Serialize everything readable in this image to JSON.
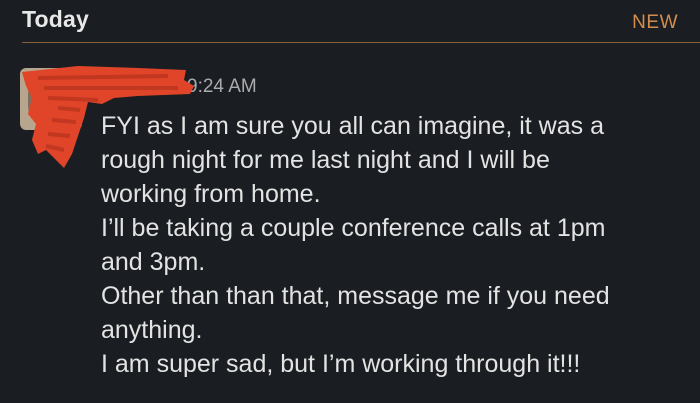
{
  "section": {
    "title": "Today",
    "badge": "NEW"
  },
  "colors": {
    "background": "#1a1d21",
    "accent": "#d38d4e",
    "redaction": "#e0452a",
    "text": "#e3e3e3",
    "muted": "#ababad"
  },
  "message": {
    "avatar_icon": "user-avatar-photo-redacted",
    "sender_redacted": true,
    "timestamp": "9:24 AM",
    "lines": [
      "FYI as I am sure you all can imagine, it was a",
      "rough night for me last night and I will be",
      "working from home.",
      "I’ll be taking a couple conference calls at 1pm",
      "and 3pm.",
      "Other than than that, message me if you need",
      "anything.",
      "I am super sad, but I’m working through it!!!"
    ]
  }
}
